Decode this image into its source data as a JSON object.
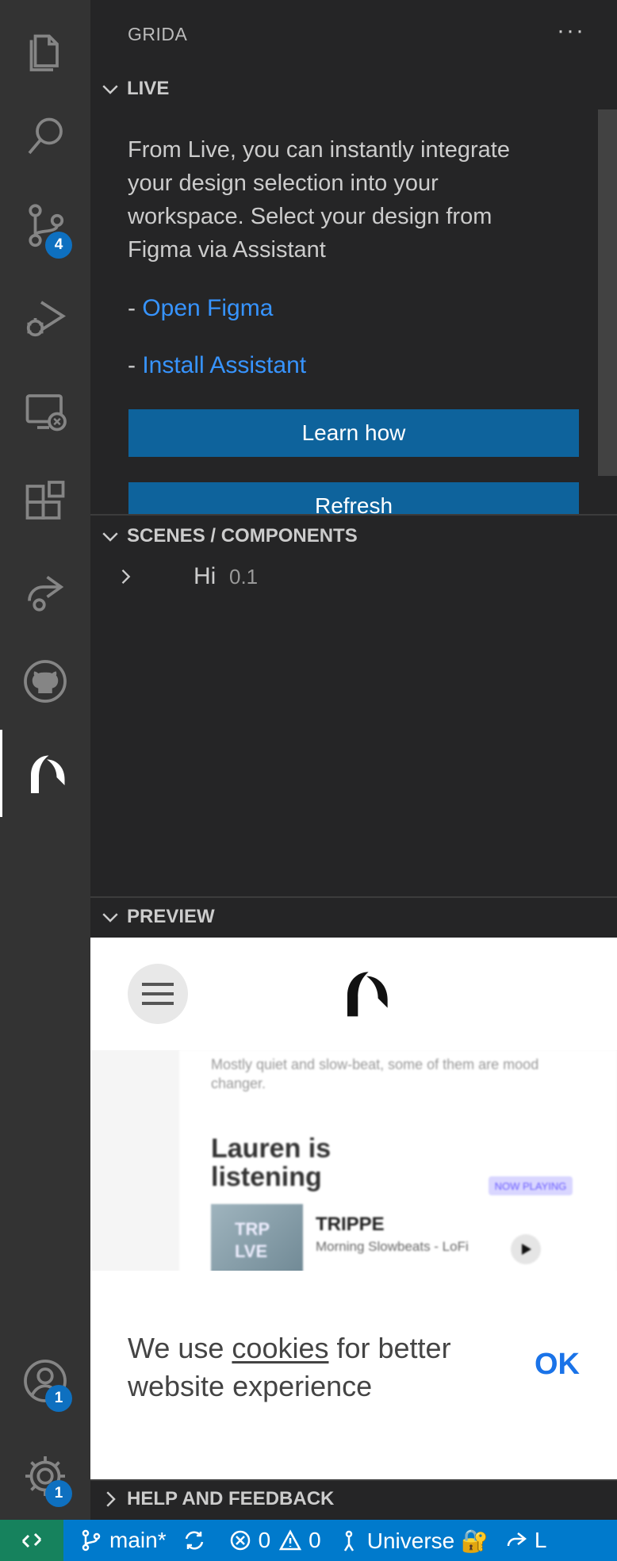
{
  "activity_bar": {
    "items": [
      {
        "icon": "files-icon"
      },
      {
        "icon": "search-icon"
      },
      {
        "icon": "source-control-icon",
        "badge": "4"
      },
      {
        "icon": "run-debug-icon"
      },
      {
        "icon": "remote-explorer-icon"
      },
      {
        "icon": "extensions-icon"
      },
      {
        "icon": "live-share-icon"
      },
      {
        "icon": "github-icon"
      },
      {
        "icon": "grida-icon",
        "active": true
      }
    ],
    "accounts_badge": "1",
    "settings_badge": "1"
  },
  "sidebar": {
    "title": "GRIDA",
    "more": "···",
    "live": {
      "header": "LIVE",
      "description": "From Live, you can instantly integrate your design selection into your workspace. Select your design from Figma via Assistant",
      "link_prefix": "- ",
      "open_figma": "Open Figma",
      "install_assistant": "Install Assistant",
      "learn_how": "Learn how",
      "refresh": "Refresh"
    },
    "scenes": {
      "header": "SCENES / COMPONENTS",
      "items": [
        {
          "name": "Hi",
          "version": "0.1"
        }
      ]
    },
    "preview": {
      "header": "PREVIEW",
      "subtitle": "Mostly quiet and slow-beat, some of them are mood changer.",
      "heading": "Lauren is listening",
      "tag": "NOW PLAYING",
      "cover_text": "TRP LVE",
      "track_title": "TRIPPE",
      "track_subtitle": "Morning Slowbeats - LoFi",
      "cookie_prefix": "We use",
      "cookie_link": "cookies",
      "cookie_suffix": "for better website experience",
      "cookie_ok": "OK"
    },
    "help": {
      "header": "HELP AND FEEDBACK"
    }
  },
  "status_bar": {
    "branch": "main*",
    "errors": "0",
    "warnings": "0",
    "universe": "Universe 🔐",
    "live_share": "L"
  },
  "colors": {
    "accent": "#007acc",
    "button": "#0e639c",
    "link": "#3794ff",
    "remote": "#16825d"
  }
}
